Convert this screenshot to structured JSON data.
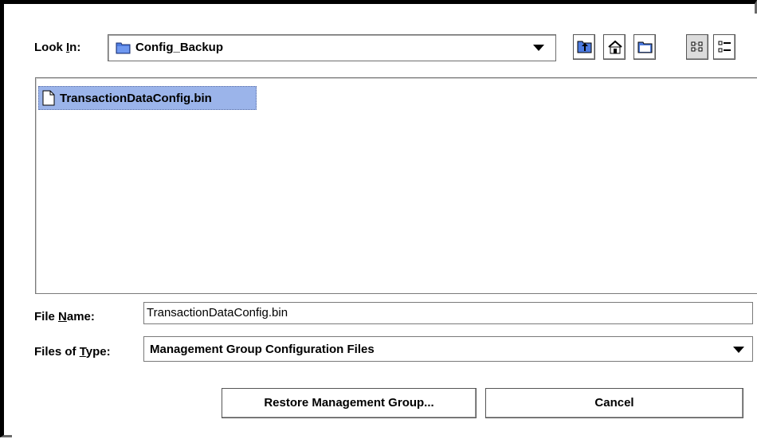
{
  "look_in": {
    "label_prefix": "Look ",
    "label_mnemonic": "I",
    "label_suffix": "n:",
    "value": "Config_Backup"
  },
  "toolbar": [
    {
      "name": "up-one-level-icon"
    },
    {
      "name": "home-icon"
    },
    {
      "name": "new-folder-icon"
    },
    {
      "name": "list-view-icon"
    },
    {
      "name": "details-view-icon"
    }
  ],
  "files": [
    {
      "name": "TransactionDataConfig.bin",
      "selected": true
    }
  ],
  "file_name": {
    "label_prefix": "File ",
    "label_mnemonic": "N",
    "label_suffix": "ame:",
    "value": "TransactionDataConfig.bin"
  },
  "file_type": {
    "label_prefix": "Files of ",
    "label_mnemonic": "T",
    "label_suffix": "ype:",
    "value": "Management Group Configuration Files"
  },
  "buttons": {
    "restore": "Restore Management Group...",
    "cancel": "Cancel"
  },
  "colors": {
    "selection": "#9bb4ea",
    "folder": "#4d7be0"
  }
}
